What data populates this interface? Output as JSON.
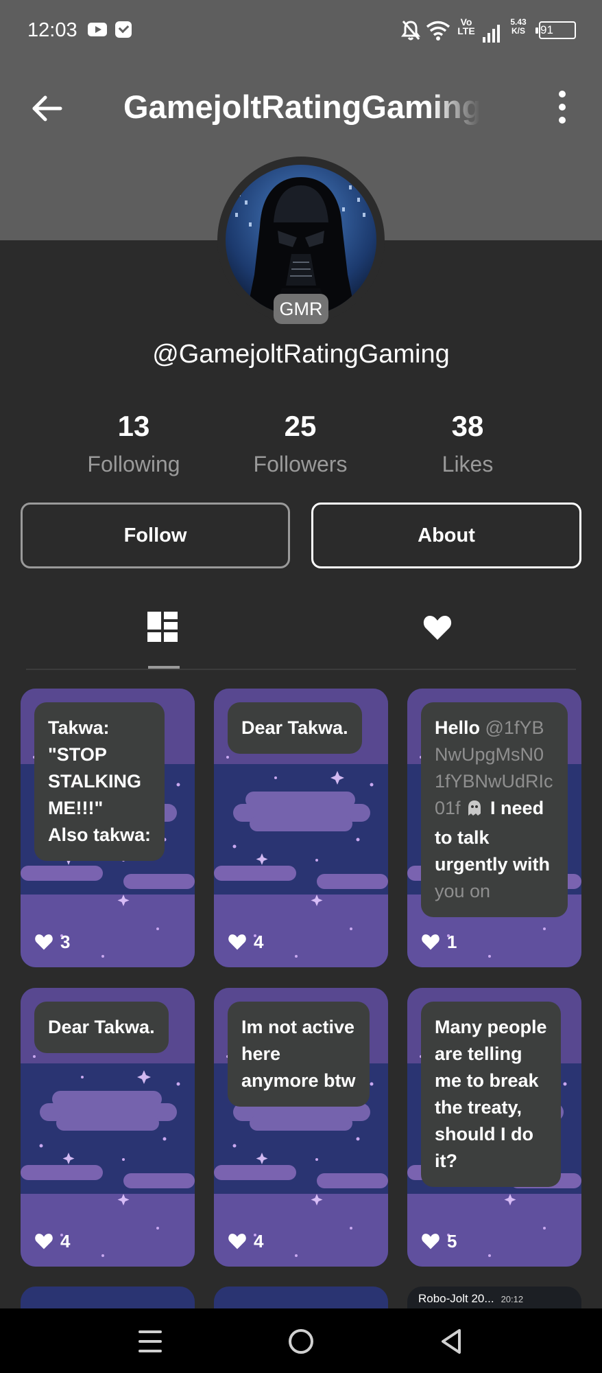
{
  "status_bar": {
    "time": "12:03",
    "volte_top": "Vo",
    "volte_bottom": "LTE",
    "speed_top": "5.43",
    "speed_bottom": "K/S",
    "battery": "91",
    "icons": [
      "youtube-icon",
      "mail-check-icon",
      "bell-off-icon",
      "wifi-icon",
      "signal-icon",
      "battery-icon"
    ]
  },
  "toolbar": {
    "title": "GamejoltRatingGaming",
    "back_icon": "arrow-left-icon",
    "more_icon": "more-vertical-icon"
  },
  "profile": {
    "avatar_icon": "darth-vader-avatar",
    "tag": "GMR",
    "username": "@GamejoltRatingGaming"
  },
  "stats": [
    {
      "value": "13",
      "label": "Following"
    },
    {
      "value": "25",
      "label": "Followers"
    },
    {
      "value": "38",
      "label": "Likes"
    }
  ],
  "actions": {
    "follow_label": "Follow",
    "about_label": "About"
  },
  "tabs": {
    "posts_icon": "grid-layout-icon",
    "likes_icon": "heart-icon",
    "active": "posts"
  },
  "posts": [
    {
      "lines": [
        "Takwa:",
        "\"STOP",
        "STALKING",
        "ME!!!\"",
        "Also takwa:"
      ],
      "likes": "3"
    },
    {
      "lines": [
        "Dear Takwa."
      ],
      "likes": "4"
    },
    {
      "lead": "Hello ",
      "mention": "@1fYBNwUpgMsN01fYBNwUdRIc01f",
      "emoji": "ghost-emoji",
      "tail": " I need to talk urgently with ",
      "faded": "you on",
      "likes": "1"
    },
    {
      "lines": [
        "Dear Takwa."
      ],
      "likes": "4"
    },
    {
      "lines": [
        "Im not active",
        "here",
        "anymore btw"
      ],
      "likes": "4"
    },
    {
      "lines": [
        "Many people",
        "are telling",
        "me to break",
        "the treaty,",
        "should I do",
        "it?"
      ],
      "likes": "5"
    }
  ],
  "peek": {
    "title": "Robo-Jolt 20...",
    "time": "20:12"
  },
  "nav": {
    "icons": [
      "menu-icon",
      "home-circle-icon",
      "back-triangle-icon"
    ]
  },
  "colors": {
    "header": "#5e5e5e",
    "background": "#2b2b2b",
    "bubble": "#3d3f3e",
    "card_navy": "#2a3472",
    "card_purple": "#7a5ea8"
  }
}
